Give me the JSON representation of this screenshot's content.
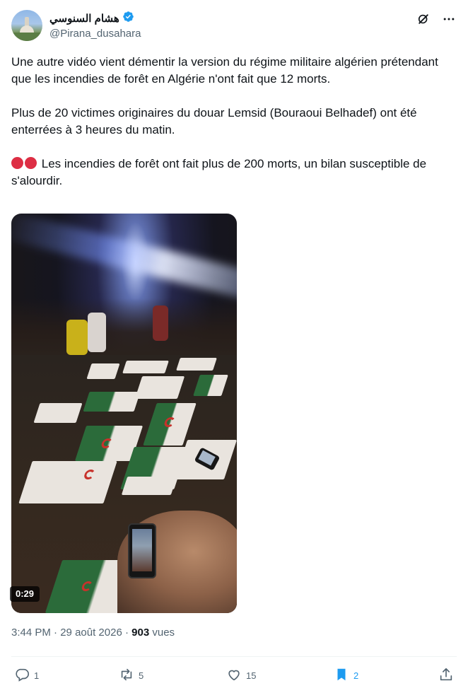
{
  "author": {
    "display_name": "هشام السنوسي",
    "handle": "@Pirana_dusahara",
    "verified": true,
    "verified_color": "#1d9bf0"
  },
  "header_actions": [
    {
      "icon": "grok-icon"
    },
    {
      "icon": "more-options-icon"
    }
  ],
  "tweet": {
    "paragraph_1": "Une autre vidéo vient démentir la version du régime militaire algérien prétendant que les incendies de forêt en Algérie n'ont fait que 12 morts.",
    "paragraph_2": "Plus de 20 victimes originaires du douar Lemsid (Bouraoui Belhadef) ont été enterrées à 3 heures du matin.",
    "paragraph_3": "Les incendies de forêt ont fait plus de 200 morts, un bilan susceptible de s'alourdir.",
    "emoji": [
      "red-circle",
      "red-circle"
    ]
  },
  "media": {
    "type": "video",
    "duration": "0:29"
  },
  "meta": {
    "time": "3:44 PM",
    "separator": "·",
    "date": "29 août 2026",
    "views_count": "903",
    "views_label": "vues"
  },
  "actions": {
    "reply": {
      "icon": "reply-icon",
      "count": "1"
    },
    "repost": {
      "icon": "repost-icon",
      "count": "5"
    },
    "like": {
      "icon": "heart-icon",
      "count": "15"
    },
    "bookmark": {
      "icon": "bookmark-icon",
      "count": "2",
      "active": true
    },
    "share": {
      "icon": "share-icon"
    }
  },
  "colors": {
    "text": "#0f1419",
    "secondary": "#536471",
    "accent": "#1d9bf0",
    "emoji_red": "#dd2e44"
  }
}
